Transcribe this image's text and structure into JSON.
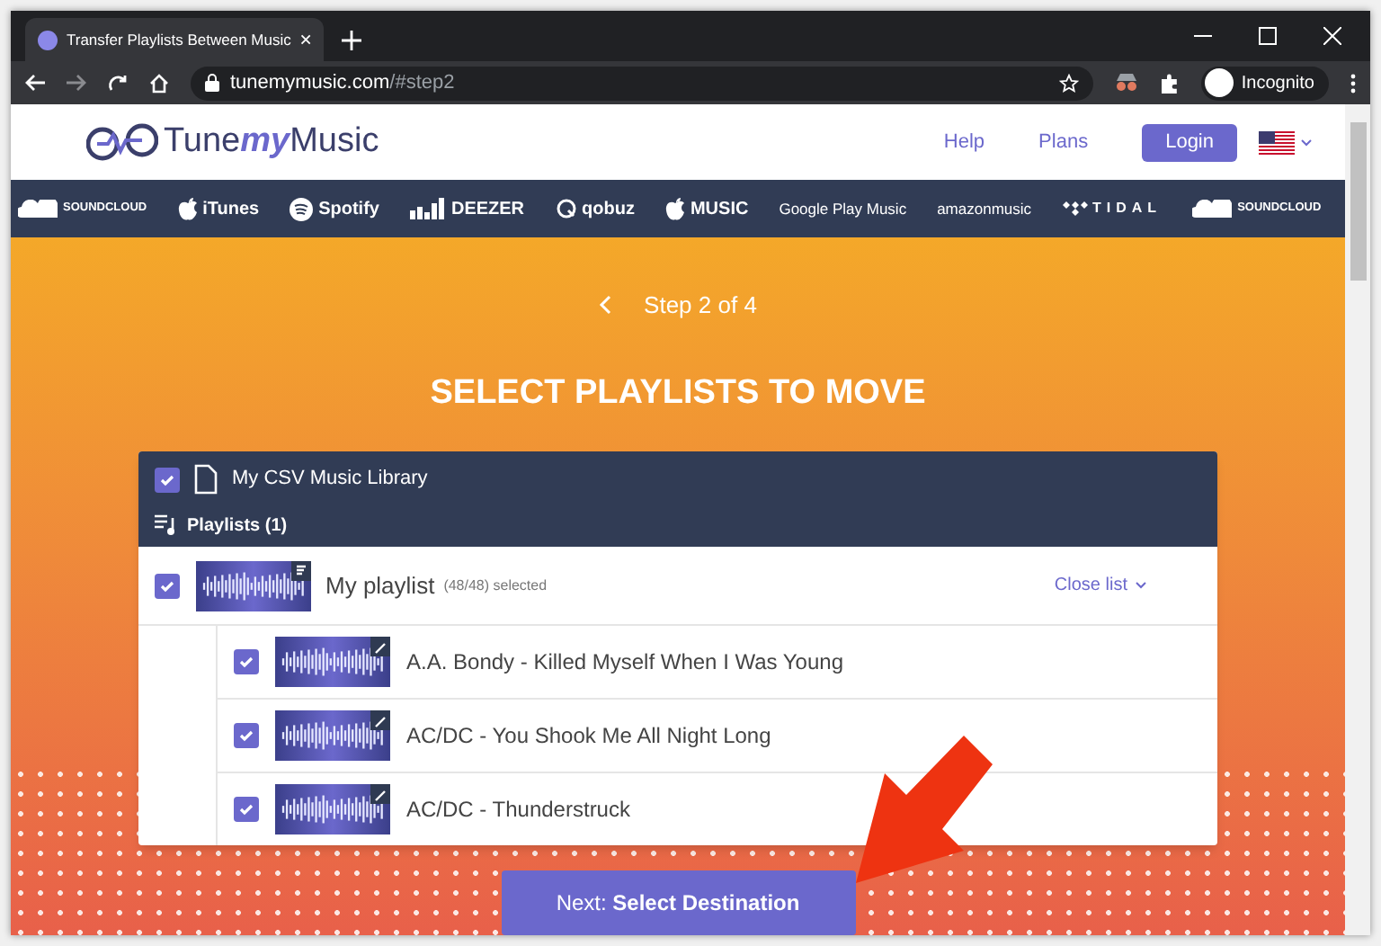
{
  "browser": {
    "tab_title": "Transfer Playlists Between Music ",
    "url_host": "tunemymusic.com",
    "url_path": "/#step2",
    "profile": "Incognito"
  },
  "site": {
    "logo": "Tune**my**Music",
    "nav": [
      {
        "label": "Help"
      },
      {
        "label": "Plans"
      }
    ],
    "login": "Login"
  },
  "services": [
    {
      "kind": "cloud",
      "label": "SOUNDCLOUD"
    },
    {
      "kind": "apple",
      "label": "iTunes"
    },
    {
      "kind": "spotify",
      "label": "Spotify"
    },
    {
      "kind": "bars",
      "label": "DEEZER"
    },
    {
      "kind": "qobuz",
      "label": "qobuz"
    },
    {
      "kind": "apple",
      "label": "MUSIC"
    },
    {
      "kind": "plain",
      "label": "Google Play Music"
    },
    {
      "kind": "plain",
      "label": "amazonmusic"
    },
    {
      "kind": "tidal",
      "label": "TIDAL"
    },
    {
      "kind": "cloud",
      "label": "SOUNDCLOUD"
    }
  ],
  "step": "Step 2 of 4",
  "heading": "SELECT PLAYLISTS TO MOVE",
  "library": {
    "name": "My CSV Music Library",
    "checked": true,
    "section": "Playlists (1)",
    "playlist": {
      "name": "My playlist",
      "count": "(48/48) selected",
      "checked": true,
      "toggle": "Close list"
    },
    "tracks": [
      {
        "title": "A.A. Bondy - Killed Myself When I Was Young",
        "checked": true
      },
      {
        "title": "AC/DC - You Shook Me All Night Long",
        "checked": true
      },
      {
        "title": "AC/DC - Thunderstruck",
        "checked": true
      }
    ]
  },
  "next": {
    "prefix": "Next: ",
    "label": "Select Destination"
  }
}
